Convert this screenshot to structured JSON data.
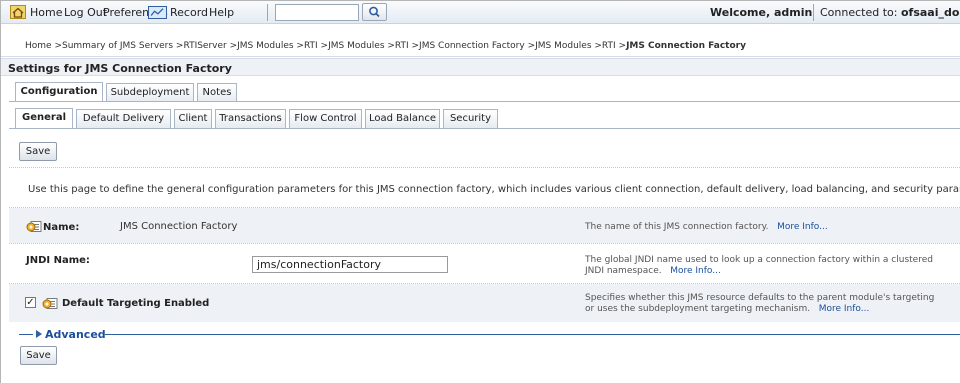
{
  "toolbar": {
    "home_label": "Home",
    "logout_label": "Log Out",
    "preferences_label": "Preferences",
    "record_label": "Record",
    "help_label": "Help",
    "search_value": "",
    "welcome_text": "Welcome, admin",
    "connected_prefix": "Connected to:",
    "connected_domain": "ofsaai_doma"
  },
  "breadcrumb": {
    "path": "Home >Summary of JMS Servers >RTIServer >JMS Modules >RTI >JMS Modules >RTI >JMS Connection Factory >JMS Modules >RTI >",
    "current": "JMS Connection Factory"
  },
  "settings_title": "Settings for JMS Connection Factory",
  "main_tabs": [
    {
      "label": "Configuration",
      "active": true
    },
    {
      "label": "Subdeployment",
      "active": false
    },
    {
      "label": "Notes",
      "active": false
    }
  ],
  "sub_tabs": [
    {
      "label": "General",
      "active": true
    },
    {
      "label": "Default Delivery",
      "active": false
    },
    {
      "label": "Client",
      "active": false
    },
    {
      "label": "Transactions",
      "active": false
    },
    {
      "label": "Flow Control",
      "active": false
    },
    {
      "label": "Load Balance",
      "active": false
    },
    {
      "label": "Security",
      "active": false
    }
  ],
  "save_label": "Save",
  "intro_text": "Use this page to define the general configuration parameters for this JMS connection factory, which includes various client connection, default delivery, load balancing, and security parameters.",
  "fields": {
    "name": {
      "label": "Name:",
      "value": "JMS Connection Factory",
      "help": "The name of this JMS connection factory.",
      "more": "More Info..."
    },
    "jndi": {
      "label": "JNDI Name:",
      "value": "jms/connectionFactory",
      "help_line1": "The global JNDI name used to look up a connection factory within a clustered",
      "help_line2": "JNDI namespace.",
      "more": "More Info..."
    },
    "targeting": {
      "label": "Default Targeting Enabled",
      "checked": true,
      "check_glyph": "✓",
      "help_line1": "Specifies whether this JMS resource defaults to the parent module's targeting",
      "help_line2": "or uses the subdeployment targeting mechanism.",
      "more": "More Info..."
    }
  },
  "advanced_label": "Advanced",
  "colors": {
    "link": "#1a4f9c",
    "accent": "#2f5f9e",
    "header_bg": "#eef2f7"
  }
}
